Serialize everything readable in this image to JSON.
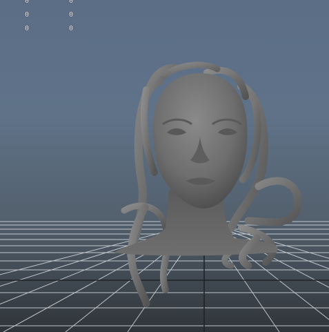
{
  "viewport": {
    "background_top": "#5b6e86",
    "background_bottom": "#2f3439",
    "grid_color": "#d8dde3",
    "model_color": "#6b6b6b"
  },
  "hud": {
    "rows": [
      {
        "col1": "0",
        "col2": "0"
      },
      {
        "col1": "0",
        "col2": "0"
      },
      {
        "col1": "0",
        "col2": "0"
      }
    ]
  },
  "scene": {
    "model_name": "medusa-head-icon"
  }
}
